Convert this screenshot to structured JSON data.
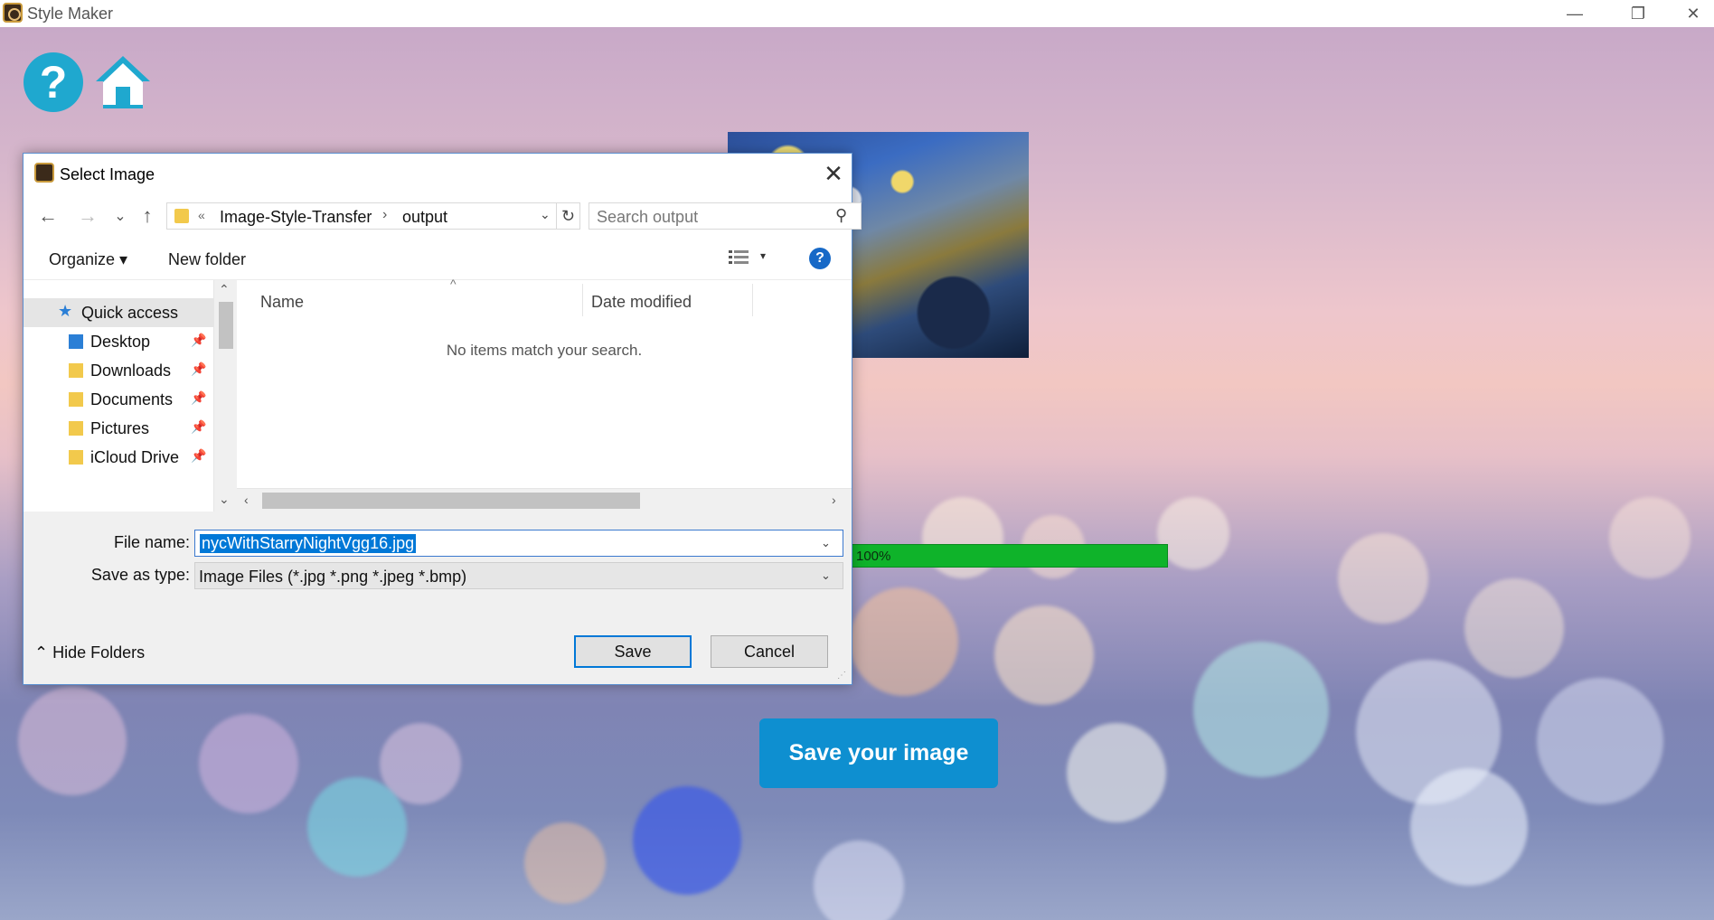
{
  "app": {
    "title": "Style Maker",
    "window_controls": {
      "minimize": "—",
      "restore": "❐",
      "close": "✕"
    }
  },
  "main": {
    "progress_value": 100,
    "progress_label": "100%",
    "save_button_label": "Save your image",
    "colors": {
      "accent": "#0e8fd0",
      "progress": "#0fb32a",
      "help": "#1fa8cf"
    },
    "icons": [
      "help-icon",
      "home-icon"
    ]
  },
  "dialog": {
    "title": "Select Image",
    "close_glyph": "✕",
    "nav": {
      "back": "←",
      "forward": "→",
      "recent": "⌄",
      "up": "↑"
    },
    "address": {
      "overflow": "«",
      "segments": [
        "Image-Style-Transfer",
        "output"
      ],
      "separator": "›",
      "dropdown": "⌄",
      "refresh": "↻"
    },
    "search_placeholder": "Search output",
    "search_glyph": "⚲",
    "commands": {
      "organize": "Organize ▾",
      "new_folder": "New folder",
      "view_dropdown": "▾",
      "help": "?"
    },
    "nav_pane": {
      "scroll_up": "⌃",
      "scroll_down": "⌄",
      "items": [
        {
          "label": "Quick access",
          "selected": true
        },
        {
          "label": "Desktop",
          "pin": "📌"
        },
        {
          "label": "Downloads",
          "pin": "📌"
        },
        {
          "label": "Documents",
          "pin": "📌"
        },
        {
          "label": "Pictures",
          "pin": "📌"
        },
        {
          "label": "iCloud Drive",
          "pin": "📌"
        }
      ]
    },
    "file_pane": {
      "columns": [
        "Name",
        "Date modified"
      ],
      "sort_caret": "^",
      "empty_message": "No items match your search.",
      "scroll_left": "‹",
      "scroll_right": "›"
    },
    "fields": {
      "file_name_label": "File name:",
      "file_name_value": "nycWithStarryNightVgg16.jpg",
      "save_type_label": "Save as type:",
      "save_type_value": "Image Files (*.jpg *.png *.jpeg *.bmp)",
      "dropdown_glyph": "⌄"
    },
    "footer": {
      "hide_folders": "⌃  Hide Folders",
      "save": "Save",
      "cancel": "Cancel"
    }
  }
}
